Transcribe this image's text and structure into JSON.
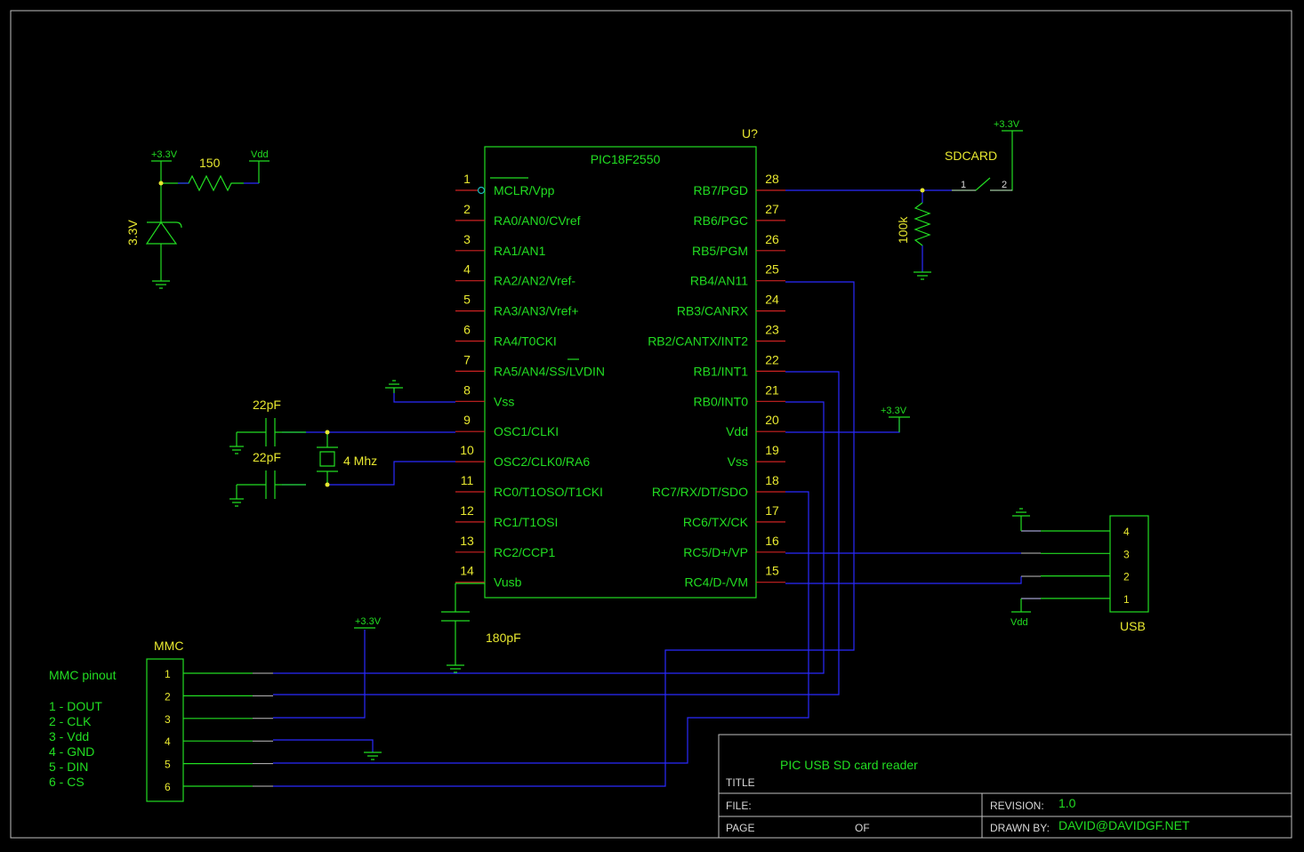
{
  "colors": {
    "background": "#000000",
    "component": "#22dd22",
    "wire": "#2a2aff",
    "pin_number": "#e8e830",
    "frame": "#bfbfbf"
  },
  "mcu": {
    "ref": "U?",
    "part": "PIC18F2550",
    "left_pins": [
      {
        "num": "1",
        "name": "MCLR/Vpp"
      },
      {
        "num": "2",
        "name": "RA0/AN0/CVref"
      },
      {
        "num": "3",
        "name": "RA1/AN1"
      },
      {
        "num": "4",
        "name": "RA2/AN2/Vref-"
      },
      {
        "num": "5",
        "name": "RA3/AN3/Vref+"
      },
      {
        "num": "6",
        "name": "RA4/T0CKI"
      },
      {
        "num": "7",
        "name": "RA5/AN4/SS/LVDIN"
      },
      {
        "num": "8",
        "name": "Vss"
      },
      {
        "num": "9",
        "name": "OSC1/CLKI"
      },
      {
        "num": "10",
        "name": "OSC2/CLK0/RA6"
      },
      {
        "num": "11",
        "name": "RC0/T1OSO/T1CKI"
      },
      {
        "num": "12",
        "name": "RC1/T1OSI"
      },
      {
        "num": "13",
        "name": "RC2/CCP1"
      },
      {
        "num": "14",
        "name": "Vusb"
      }
    ],
    "right_pins": [
      {
        "num": "28",
        "name": "RB7/PGD"
      },
      {
        "num": "27",
        "name": "RB6/PGC"
      },
      {
        "num": "26",
        "name": "RB5/PGM"
      },
      {
        "num": "25",
        "name": "RB4/AN11"
      },
      {
        "num": "24",
        "name": "RB3/CANRX"
      },
      {
        "num": "23",
        "name": "RB2/CANTX/INT2"
      },
      {
        "num": "22",
        "name": "RB1/INT1"
      },
      {
        "num": "21",
        "name": "RB0/INT0"
      },
      {
        "num": "20",
        "name": "Vdd"
      },
      {
        "num": "19",
        "name": "Vss"
      },
      {
        "num": "18",
        "name": "RC7/RX/DT/SDO"
      },
      {
        "num": "17",
        "name": "RC6/TX/CK"
      },
      {
        "num": "16",
        "name": "RC5/D+/VP"
      },
      {
        "num": "15",
        "name": "RC4/D-/VM"
      }
    ]
  },
  "power": {
    "v33": "+3.3V",
    "vdd": "Vdd",
    "resistor_150": "150",
    "diode_label": "3.3V"
  },
  "oscillator": {
    "cap_top": "22pF",
    "cap_bottom": "22pF",
    "crystal": "4 Mhz"
  },
  "vusb_cap": "180pF",
  "sdcard": {
    "label": "SDCARD",
    "pin1": "1",
    "pin2": "2",
    "resistor": "100k"
  },
  "usb": {
    "label": "USB",
    "pins": [
      "4",
      "3",
      "2",
      "1"
    ],
    "vdd": "Vdd"
  },
  "mmc": {
    "label": "MMC",
    "pins": [
      "1",
      "2",
      "3",
      "4",
      "5",
      "6"
    ],
    "pinout_title": "MMC pinout",
    "pinout": [
      "1 - DOUT",
      "2 - CLK",
      "3 - Vdd",
      "4 - GND",
      "5 - DIN",
      "6 - CS"
    ]
  },
  "title_block": {
    "title_value": "PIC USB SD card reader",
    "title_label": "TITLE",
    "file_label": "FILE:",
    "page_label": "PAGE",
    "of_label": "OF",
    "revision_label": "REVISION:",
    "revision_value": "1.0",
    "drawn_by_label": "DRAWN BY:",
    "drawn_by_value": "DAVID@DAVIDGF.NET"
  }
}
